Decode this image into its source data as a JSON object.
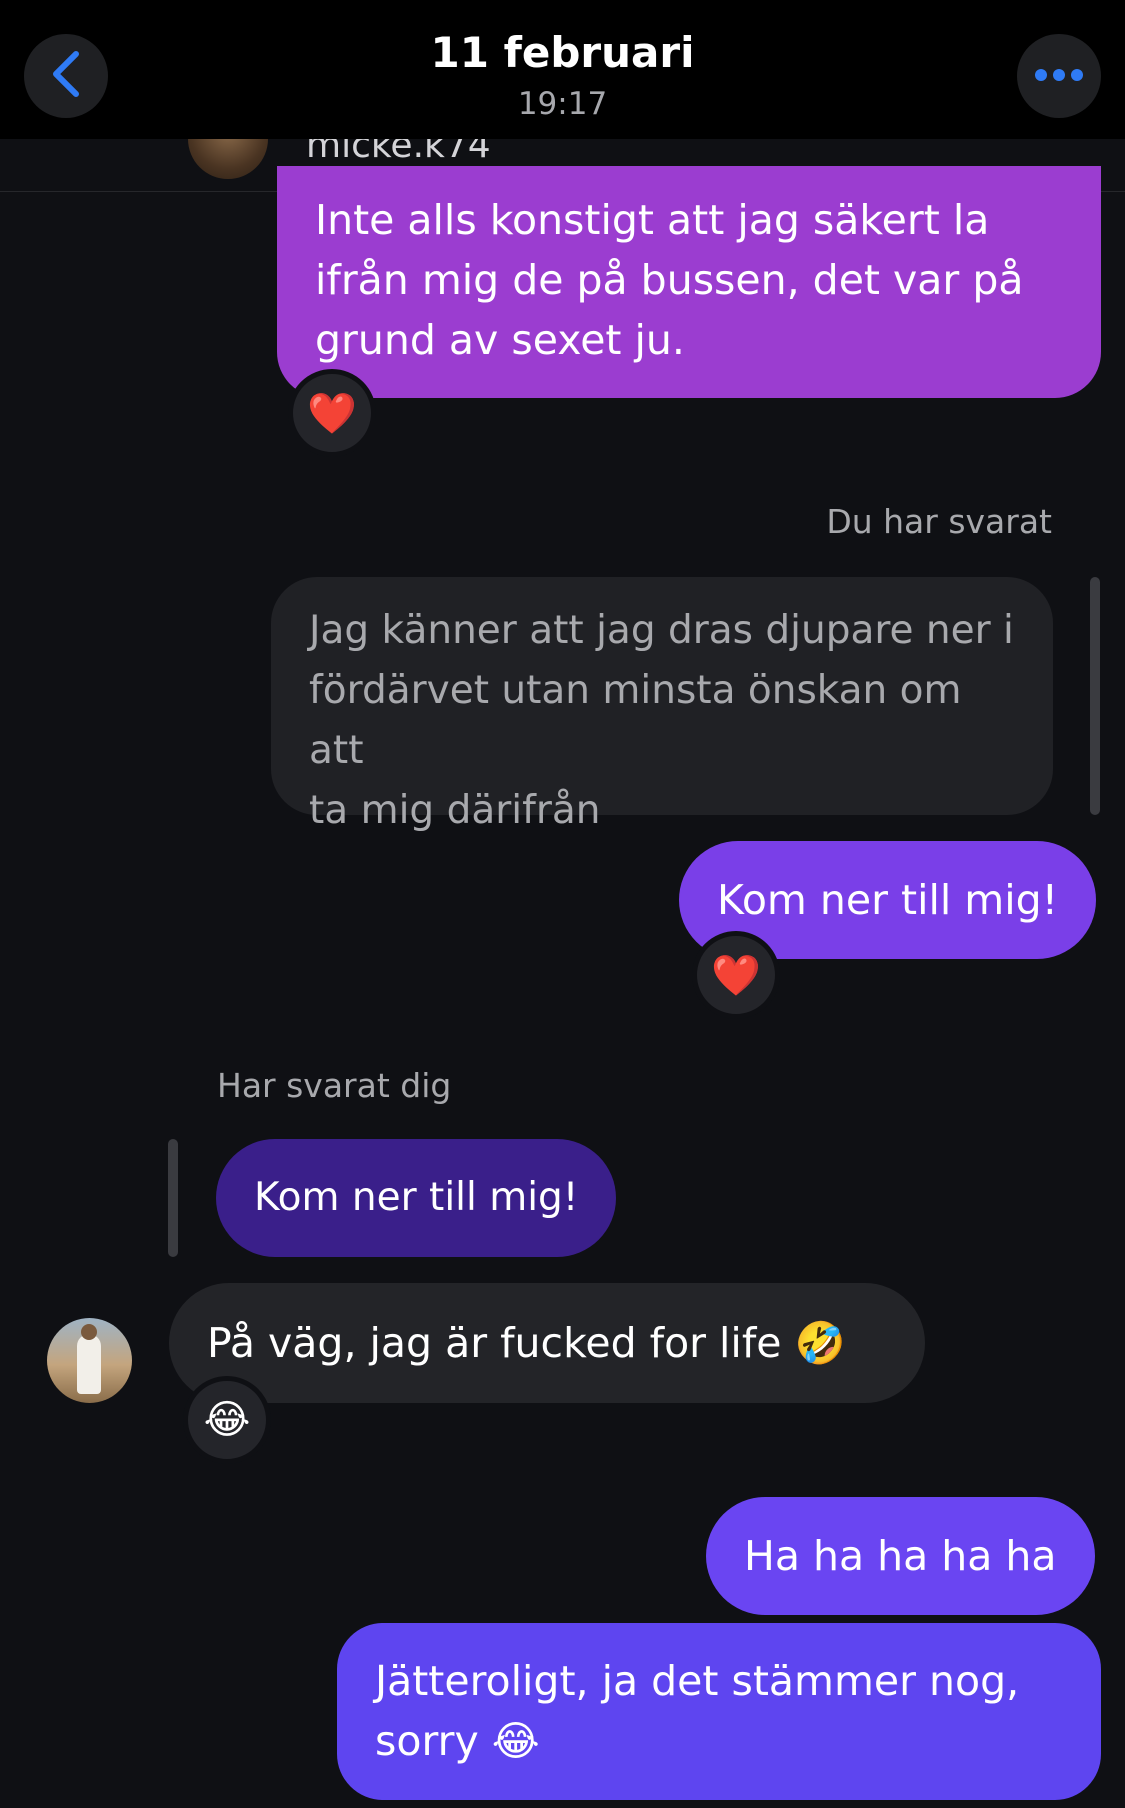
{
  "header": {
    "date": "11 februari",
    "time": "19:17"
  },
  "profile_strip": {
    "username": "micke.k74"
  },
  "messages": {
    "msg1": "Inte alls konstigt att jag säkert la\nifrån mig de på bussen, det var på\ngrund av sexet ju.",
    "msg1_reaction": "❤️",
    "reply_to_label": "Du har svarat",
    "quoted_text": "Jag känner att jag dras djupare ner i\nfördärvet utan minsta önskan om att\nta mig därifrån",
    "msg2": "Kom ner till mig!",
    "msg2_reaction": "❤️",
    "replied_label": "Har svarat dig",
    "quoted_text_2": "Kom ner till mig!",
    "msg3": "På väg, jag är fucked for life 🤣",
    "msg3_reaction": "😂",
    "msg4": "Ha ha ha ha ha",
    "msg5": "Jätteroligt, ja det stämmer nog,\nsorry 😂"
  },
  "icons": {
    "back": "chevron-left-icon",
    "more": "more-dots-icon"
  },
  "colors": {
    "accent_blue": "#2f7bf5",
    "bubble_purple_magenta": "#9b3dd0",
    "bubble_purple": "#7a3fe8",
    "bubble_indigo": "#5e45f0",
    "bubble_received": "#232428"
  }
}
